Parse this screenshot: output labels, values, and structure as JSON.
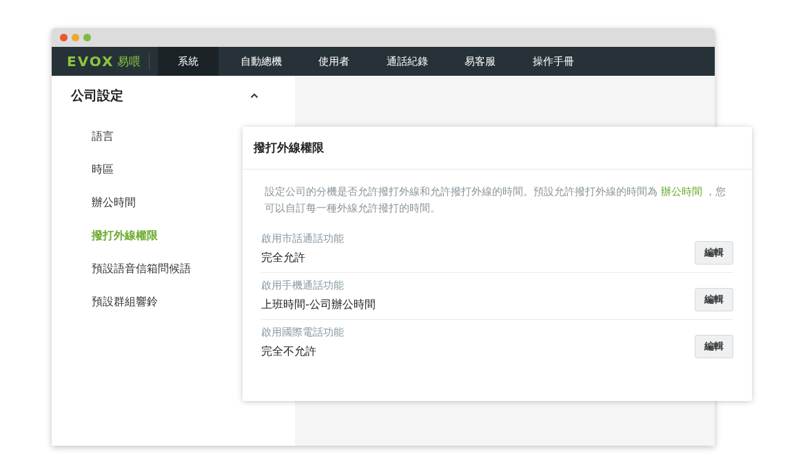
{
  "logo": {
    "wordmark": "EVOX",
    "name": "易喂"
  },
  "nav": [
    {
      "label": "系統",
      "selected": true
    },
    {
      "label": "自動總機",
      "selected": false
    },
    {
      "label": "使用者",
      "selected": false
    },
    {
      "label": "通話紀錄",
      "selected": false
    },
    {
      "label": "易客服",
      "selected": false
    },
    {
      "label": "操作手冊",
      "selected": false
    }
  ],
  "sidebar": {
    "title": "公司設定",
    "expanded": true,
    "items": [
      {
        "label": "語言",
        "selected": false
      },
      {
        "label": "時區",
        "selected": false
      },
      {
        "label": "辦公時間",
        "selected": false
      },
      {
        "label": "撥打外線權限",
        "selected": true
      },
      {
        "label": "預設語音信箱問候語",
        "selected": false
      },
      {
        "label": "預設群組響鈴",
        "selected": false
      }
    ]
  },
  "panel": {
    "title": "撥打外線權限",
    "description": {
      "before": "設定公司的分機是否允許撥打外線和允許撥打外線的時間。預設允許撥打外線的時間為 ",
      "link": "辦公時間",
      "after": " ，您可以自訂每一種外線允許撥打的時間。"
    },
    "settings": [
      {
        "label": "啟用市話通話功能",
        "value": "完全允許",
        "button": "編輯"
      },
      {
        "label": "啟用手機通話功能",
        "value": "上班時間-公司辦公時間",
        "button": "編輯"
      },
      {
        "label": "啟用國際電話功能",
        "value": "完全不允許",
        "button": "編輯"
      }
    ]
  }
}
